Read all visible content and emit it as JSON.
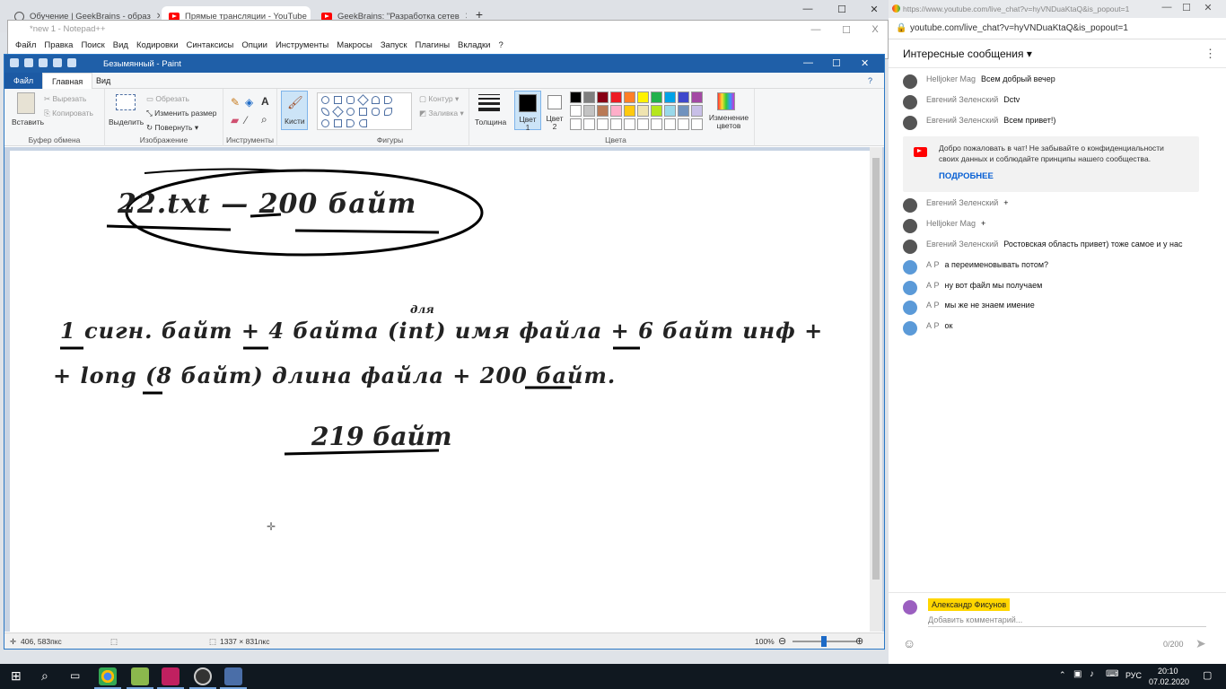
{
  "browser": {
    "tabs": [
      {
        "title": "Обучение | GeekBrains - образ"
      },
      {
        "title": "Прямые трансляции - YouTube"
      },
      {
        "title": "GeekBrains: \"Разработка сетев"
      }
    ],
    "new_tab": "+"
  },
  "notepad": {
    "title": "*new 1 - Notepad++",
    "menu": [
      "Файл",
      "Правка",
      "Поиск",
      "Вид",
      "Кодировки",
      "Синтаксисы",
      "Опции",
      "Инструменты",
      "Макросы",
      "Запуск",
      "Плагины",
      "Вкладки",
      "?"
    ],
    "close": "X"
  },
  "paint": {
    "title": "Безымянный - Paint",
    "tabs": [
      "Файл",
      "Главная",
      "Вид"
    ],
    "groups": {
      "clipboard": {
        "paste": "Вставить",
        "cut": "Вырезать",
        "copy": "Копировать",
        "caption": "Буфер обмена"
      },
      "image": {
        "select": "Выделить",
        "crop": "Обрезать",
        "resize": "Изменить размер",
        "rotate": "Повернуть",
        "caption": "Изображение"
      },
      "tools": {
        "caption": "Инструменты"
      },
      "brushes": {
        "label": "Кисти"
      },
      "shapes": {
        "outline": "Контур",
        "fill": "Заливка",
        "caption": "Фигуры"
      },
      "size": {
        "label": "Толщина"
      },
      "colors": {
        "color1": "Цвет 1",
        "color2": "Цвет 2",
        "edit": "Изменение цветов",
        "caption": "Цвета"
      }
    },
    "palette_row1": [
      "#000000",
      "#7f7f7f",
      "#880015",
      "#ed1c24",
      "#ff7f27",
      "#fff200",
      "#22b14c",
      "#00a2e8",
      "#3f48cc",
      "#a349a4"
    ],
    "palette_row2": [
      "#ffffff",
      "#c3c3c3",
      "#b97a57",
      "#ffaec9",
      "#ffc90e",
      "#efe4b0",
      "#b5e61d",
      "#99d9ea",
      "#7092be",
      "#c8bfe7"
    ],
    "canvas_text": {
      "line1": "22.txt — 200 байт",
      "line2": "1 сигн. байт + 4 байта (int) имя файла + 6 байт инф +",
      "note_over": "для",
      "line3": "+ long (8 байт) длина файла + 200 байт.",
      "line4": "219 байт"
    },
    "status": {
      "cursor": "406, 583пкс",
      "size": "1337 × 831пкс",
      "zoom": "100%"
    }
  },
  "chat": {
    "url": "https://www.youtube.com/live_chat?v=hyVNDuaKtaQ&is_popout=1",
    "address": "youtube.com/live_chat?v=hyVNDuaKtaQ&is_popout=1",
    "header": "Интересные сообщения",
    "messages": [
      {
        "author": "Helljoker Mag",
        "text": "Всем добрый вечер"
      },
      {
        "author": "Евгений Зеленский",
        "text": "Dctv"
      },
      {
        "author": "Евгений Зеленский",
        "text": "Всем привет!)"
      },
      {
        "author": "Евгений Зеленский",
        "text": "+"
      },
      {
        "author": "Helljoker Mag",
        "text": "+"
      },
      {
        "author": "Евгений Зеленский",
        "text": "Ростовская область привет) тоже самое и у нас"
      },
      {
        "author": "А Р",
        "text": "а переименовывать потом?"
      },
      {
        "author": "А Р",
        "text": "ну вот файл мы получаем"
      },
      {
        "author": "А Р",
        "text": "мы же не знаем имение"
      },
      {
        "author": "А Р",
        "text": "ок"
      }
    ],
    "welcome": {
      "text": "Добро пожаловать в чат! Не забывайте о конфиденциальности своих данных и соблюдайте принципы нашего сообщества.",
      "more": "ПОДРОБНЕЕ"
    },
    "input": {
      "user": "Александр Фисунов",
      "placeholder": "Добавить комментарий...",
      "counter": "0/200"
    }
  },
  "taskbar": {
    "lang": "РУС",
    "time": "20:10",
    "date": "07.02.2020"
  }
}
